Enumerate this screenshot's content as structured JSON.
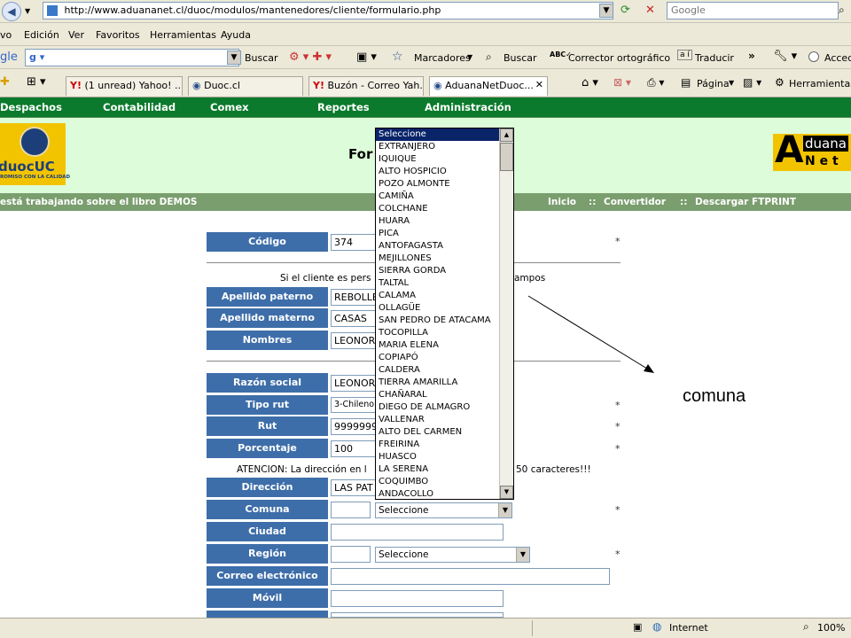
{
  "browser": {
    "url": "http://www.aduananet.cl/duoc/modulos/mantenedores/cliente/formulario.php",
    "search_placeholder": "Google",
    "menu": [
      "vo",
      "Edición",
      "Ver",
      "Favoritos",
      "Herramientas",
      "Ayuda"
    ],
    "toolbar": {
      "gle": "gle",
      "buscar": "Buscar",
      "marcadores": "Marcadores",
      "buscar2": "Buscar",
      "corrector": "Corrector ortográfico",
      "traducir": "Traducir",
      "acced": "Acced"
    },
    "tabs": [
      "(1 unread) Yahoo! ...",
      "Duoc.cl",
      "Buzón - Correo Yah...",
      "AduanaNetDuoc..."
    ],
    "tab_tools": {
      "pagina": "Página",
      "herramientas": "Herramientas"
    }
  },
  "nav": {
    "items": [
      "Despachos",
      "Contabilidad",
      "Comex",
      "Reportes",
      "Administración"
    ]
  },
  "header": {
    "logo_left": {
      "main": "duocUC",
      "tagline": "ROMISO CON LA CALIDAD"
    },
    "title_fragment": "For",
    "logo_right": {
      "aduana": "duana",
      "net": "N e t",
      "a": "A"
    }
  },
  "subbar": {
    "book_text": "está trabajando sobre el libro DEMOS",
    "links": [
      "Inicio",
      "::",
      "Convertidor",
      "::",
      "Descargar FTPRINT"
    ]
  },
  "form": {
    "codigo": {
      "label": "Código",
      "value": "374"
    },
    "note1": {
      "left": "Si el cliente es pers",
      "right": "ampos"
    },
    "apellido_paterno": {
      "label": "Apellido paterno",
      "value": "REBOLLE"
    },
    "apellido_materno": {
      "label": "Apellido materno",
      "value": "CASAS"
    },
    "nombres": {
      "label": "Nombres",
      "value": "LEONOR"
    },
    "razon_social": {
      "label": "Razón social",
      "value": "LEONOR"
    },
    "tipo_rut": {
      "label": "Tipo rut",
      "value": "3-Chileno"
    },
    "rut": {
      "label": "Rut",
      "value": "9999999"
    },
    "porcentaje": {
      "label": "Porcentaje exportador",
      "value": "100"
    },
    "note2": {
      "left": "ATENCION: La dirección en l",
      "right": "50 caracteres!!!"
    },
    "direccion": {
      "label": "Dirección",
      "value": "LAS PAT"
    },
    "comuna": {
      "label": "Comuna",
      "code": "",
      "select": "Seleccione"
    },
    "ciudad": {
      "label": "Ciudad",
      "value": ""
    },
    "region": {
      "label": "Región",
      "code": "",
      "select": "Seleccione"
    },
    "correo": {
      "label": "Correo electrónico",
      "value": ""
    },
    "movil": {
      "label": "Móvil",
      "value": ""
    },
    "required_mark": "*"
  },
  "dropdown": {
    "options": [
      "Seleccione",
      "EXTRANJERO",
      "IQUIQUE",
      "ALTO HOSPICIO",
      "POZO ALMONTE",
      "CAMIÑA",
      "COLCHANE",
      "HUARA",
      "PICA",
      "ANTOFAGASTA",
      "MEJILLONES",
      "SIERRA GORDA",
      "TALTAL",
      "CALAMA",
      "OLLAGÜE",
      "SAN PEDRO DE ATACAMA",
      "TOCOPILLA",
      "MARIA ELENA",
      "COPIAPÓ",
      "CALDERA",
      "TIERRA AMARILLA",
      "CHAÑARAL",
      "DIEGO DE ALMAGRO",
      "VALLENAR",
      "ALTO DEL CARMEN",
      "FREIRINA",
      "HUASCO",
      "LA SERENA",
      "COQUIMBO",
      "ANDACOLLO"
    ]
  },
  "annotation": {
    "text": "comuna"
  },
  "status": {
    "zone": "Internet",
    "zoom": "100%"
  }
}
